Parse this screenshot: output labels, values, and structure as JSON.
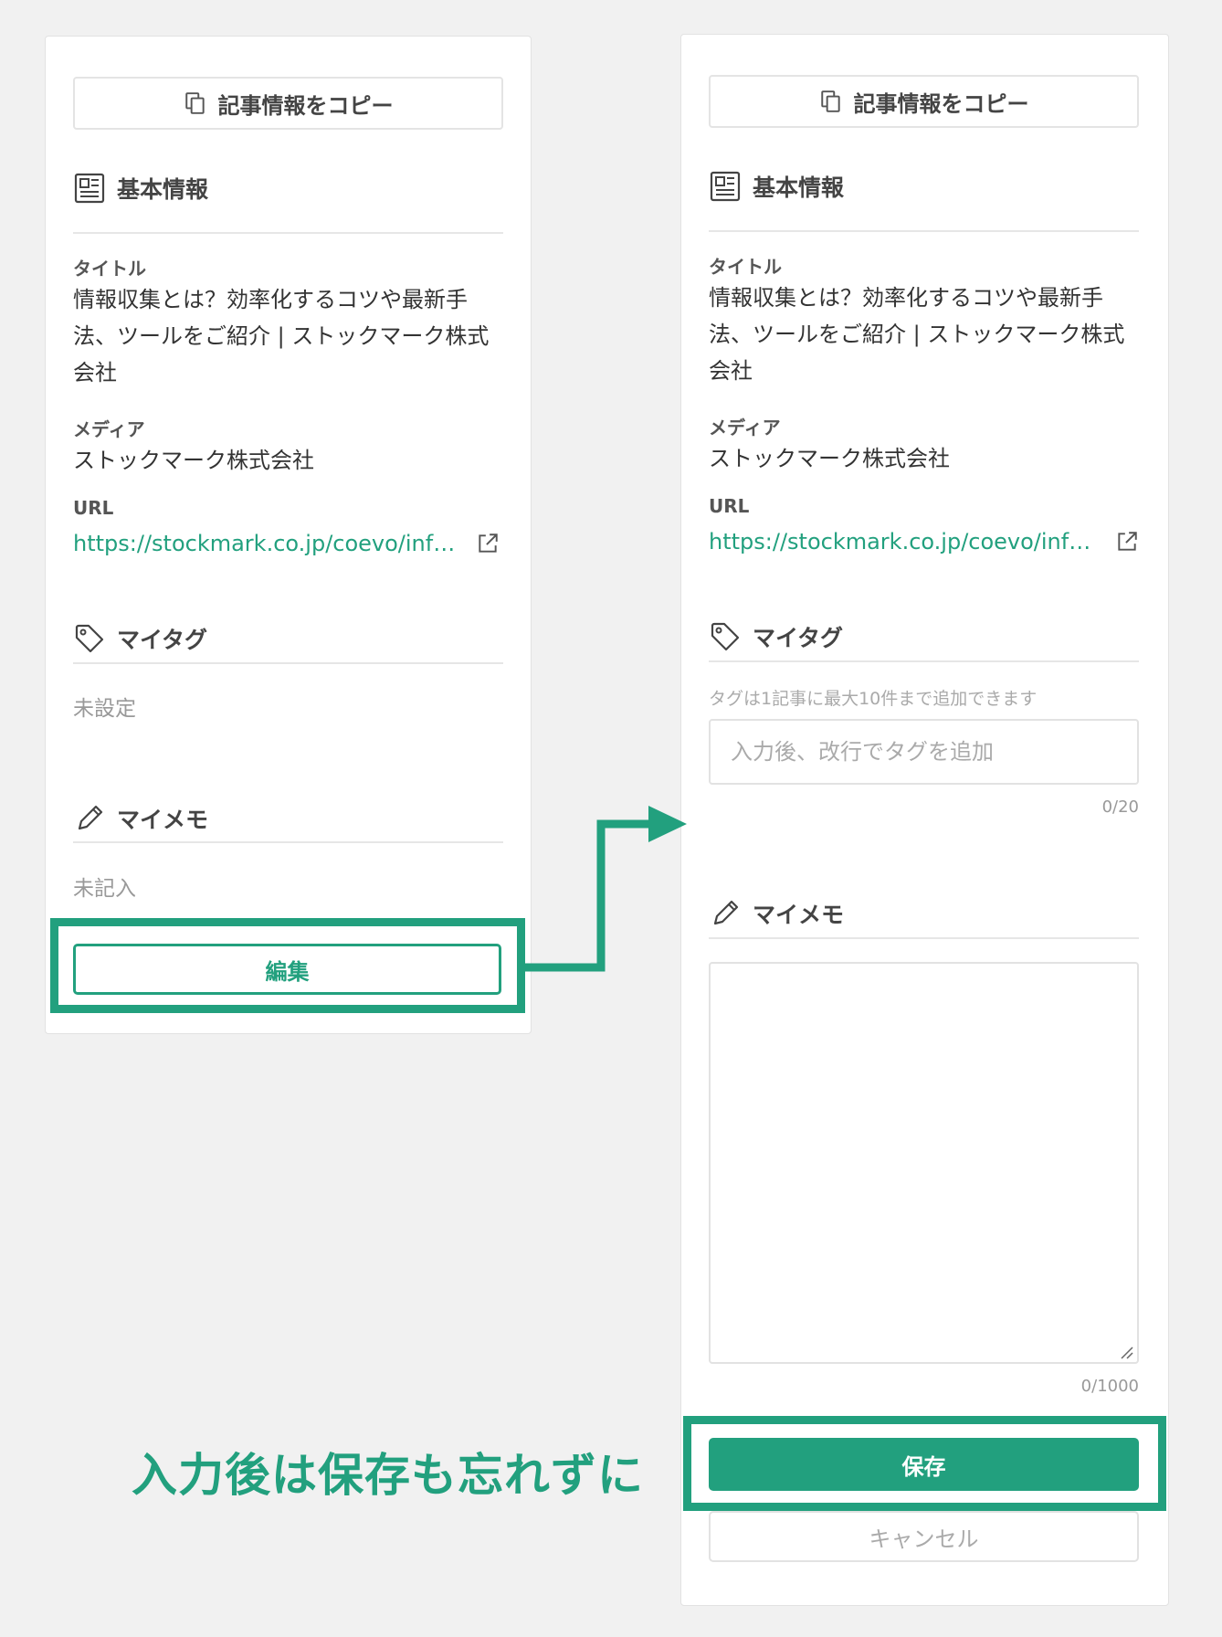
{
  "copy_button_label": "記事情報をコピー",
  "sections": {
    "basic_info": "基本情報",
    "my_tag": "マイタグ",
    "my_memo": "マイメモ"
  },
  "fields": {
    "title_label": "タイトル",
    "title_value": "情報収集とは？効率化するコツや最新手法、ツールをご紹介 | ストックマーク株式会社",
    "media_label": "メディア",
    "media_value": "ストックマーク株式会社",
    "url_label": "URL",
    "url_value": "https://stockmark.co.jp/coevo/inf…"
  },
  "left_panel": {
    "tag_empty": "未設定",
    "memo_empty": "未記入",
    "edit_button": "編集"
  },
  "right_panel": {
    "tag_hint": "タグは1記事に最大10件まで追加できます",
    "tag_placeholder": "入力後、改行でタグを追加",
    "tag_counter": "0/20",
    "memo_counter": "0/1000",
    "save_button": "保存",
    "cancel_button": "キャンセル"
  },
  "caption": "入力後は保存も忘れずに",
  "colors": {
    "accent": "#22a07e",
    "background": "#f1f1f1"
  }
}
